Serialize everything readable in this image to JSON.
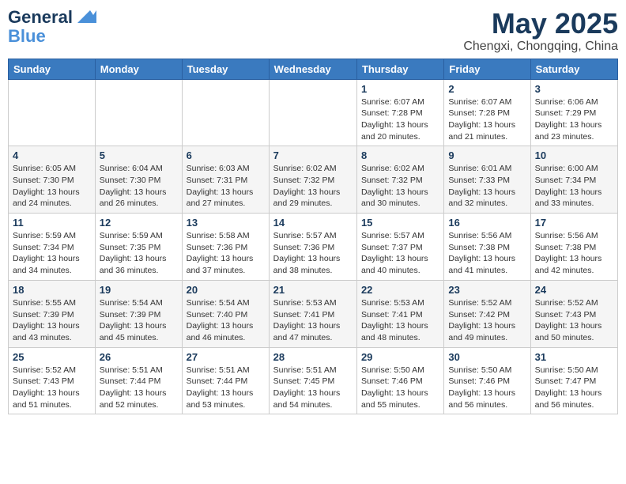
{
  "logo": {
    "line1": "General",
    "line2": "Blue"
  },
  "header": {
    "month": "May 2025",
    "location": "Chengxi, Chongqing, China"
  },
  "weekdays": [
    "Sunday",
    "Monday",
    "Tuesday",
    "Wednesday",
    "Thursday",
    "Friday",
    "Saturday"
  ],
  "weeks": [
    [
      {
        "day": "",
        "info": ""
      },
      {
        "day": "",
        "info": ""
      },
      {
        "day": "",
        "info": ""
      },
      {
        "day": "",
        "info": ""
      },
      {
        "day": "1",
        "info": "Sunrise: 6:07 AM\nSunset: 7:28 PM\nDaylight: 13 hours and 20 minutes."
      },
      {
        "day": "2",
        "info": "Sunrise: 6:07 AM\nSunset: 7:28 PM\nDaylight: 13 hours and 21 minutes."
      },
      {
        "day": "3",
        "info": "Sunrise: 6:06 AM\nSunset: 7:29 PM\nDaylight: 13 hours and 23 minutes."
      }
    ],
    [
      {
        "day": "4",
        "info": "Sunrise: 6:05 AM\nSunset: 7:30 PM\nDaylight: 13 hours and 24 minutes."
      },
      {
        "day": "5",
        "info": "Sunrise: 6:04 AM\nSunset: 7:30 PM\nDaylight: 13 hours and 26 minutes."
      },
      {
        "day": "6",
        "info": "Sunrise: 6:03 AM\nSunset: 7:31 PM\nDaylight: 13 hours and 27 minutes."
      },
      {
        "day": "7",
        "info": "Sunrise: 6:02 AM\nSunset: 7:32 PM\nDaylight: 13 hours and 29 minutes."
      },
      {
        "day": "8",
        "info": "Sunrise: 6:02 AM\nSunset: 7:32 PM\nDaylight: 13 hours and 30 minutes."
      },
      {
        "day": "9",
        "info": "Sunrise: 6:01 AM\nSunset: 7:33 PM\nDaylight: 13 hours and 32 minutes."
      },
      {
        "day": "10",
        "info": "Sunrise: 6:00 AM\nSunset: 7:34 PM\nDaylight: 13 hours and 33 minutes."
      }
    ],
    [
      {
        "day": "11",
        "info": "Sunrise: 5:59 AM\nSunset: 7:34 PM\nDaylight: 13 hours and 34 minutes."
      },
      {
        "day": "12",
        "info": "Sunrise: 5:59 AM\nSunset: 7:35 PM\nDaylight: 13 hours and 36 minutes."
      },
      {
        "day": "13",
        "info": "Sunrise: 5:58 AM\nSunset: 7:36 PM\nDaylight: 13 hours and 37 minutes."
      },
      {
        "day": "14",
        "info": "Sunrise: 5:57 AM\nSunset: 7:36 PM\nDaylight: 13 hours and 38 minutes."
      },
      {
        "day": "15",
        "info": "Sunrise: 5:57 AM\nSunset: 7:37 PM\nDaylight: 13 hours and 40 minutes."
      },
      {
        "day": "16",
        "info": "Sunrise: 5:56 AM\nSunset: 7:38 PM\nDaylight: 13 hours and 41 minutes."
      },
      {
        "day": "17",
        "info": "Sunrise: 5:56 AM\nSunset: 7:38 PM\nDaylight: 13 hours and 42 minutes."
      }
    ],
    [
      {
        "day": "18",
        "info": "Sunrise: 5:55 AM\nSunset: 7:39 PM\nDaylight: 13 hours and 43 minutes."
      },
      {
        "day": "19",
        "info": "Sunrise: 5:54 AM\nSunset: 7:39 PM\nDaylight: 13 hours and 45 minutes."
      },
      {
        "day": "20",
        "info": "Sunrise: 5:54 AM\nSunset: 7:40 PM\nDaylight: 13 hours and 46 minutes."
      },
      {
        "day": "21",
        "info": "Sunrise: 5:53 AM\nSunset: 7:41 PM\nDaylight: 13 hours and 47 minutes."
      },
      {
        "day": "22",
        "info": "Sunrise: 5:53 AM\nSunset: 7:41 PM\nDaylight: 13 hours and 48 minutes."
      },
      {
        "day": "23",
        "info": "Sunrise: 5:52 AM\nSunset: 7:42 PM\nDaylight: 13 hours and 49 minutes."
      },
      {
        "day": "24",
        "info": "Sunrise: 5:52 AM\nSunset: 7:43 PM\nDaylight: 13 hours and 50 minutes."
      }
    ],
    [
      {
        "day": "25",
        "info": "Sunrise: 5:52 AM\nSunset: 7:43 PM\nDaylight: 13 hours and 51 minutes."
      },
      {
        "day": "26",
        "info": "Sunrise: 5:51 AM\nSunset: 7:44 PM\nDaylight: 13 hours and 52 minutes."
      },
      {
        "day": "27",
        "info": "Sunrise: 5:51 AM\nSunset: 7:44 PM\nDaylight: 13 hours and 53 minutes."
      },
      {
        "day": "28",
        "info": "Sunrise: 5:51 AM\nSunset: 7:45 PM\nDaylight: 13 hours and 54 minutes."
      },
      {
        "day": "29",
        "info": "Sunrise: 5:50 AM\nSunset: 7:46 PM\nDaylight: 13 hours and 55 minutes."
      },
      {
        "day": "30",
        "info": "Sunrise: 5:50 AM\nSunset: 7:46 PM\nDaylight: 13 hours and 56 minutes."
      },
      {
        "day": "31",
        "info": "Sunrise: 5:50 AM\nSunset: 7:47 PM\nDaylight: 13 hours and 56 minutes."
      }
    ]
  ]
}
